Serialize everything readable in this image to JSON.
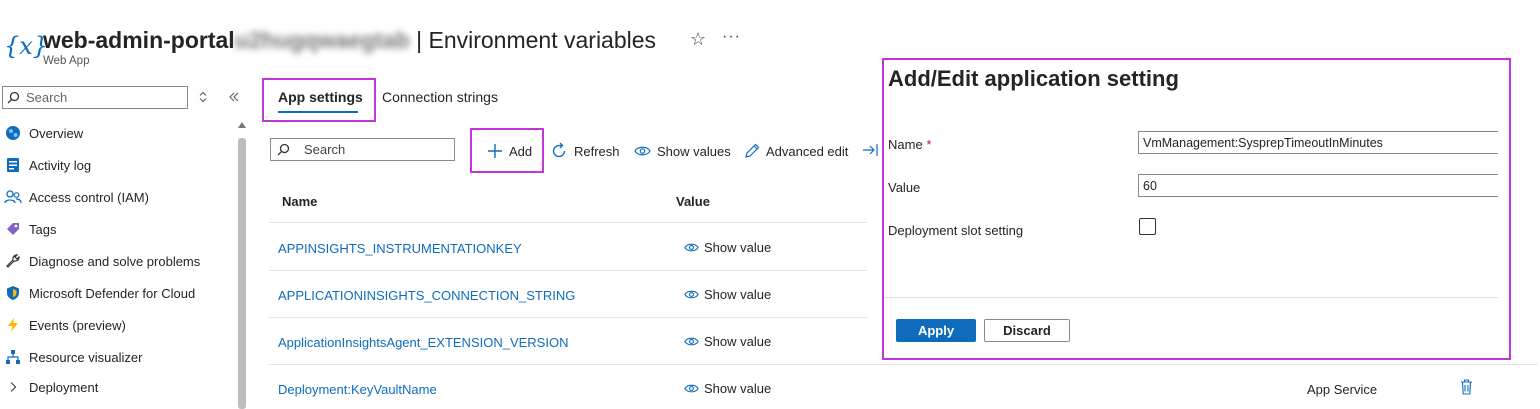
{
  "header": {
    "app_name": "web-admin-portal",
    "app_name_suffix": "u2hugqwaegtab",
    "separator_title": "| Environment variables",
    "subtitle": "Web App",
    "star_glyph": "☆",
    "more_glyph": "···"
  },
  "sidebar": {
    "search_placeholder": "Search",
    "items": [
      {
        "label": "Overview",
        "icon": "globe-icon"
      },
      {
        "label": "Activity log",
        "icon": "log-icon"
      },
      {
        "label": "Access control (IAM)",
        "icon": "people-icon"
      },
      {
        "label": "Tags",
        "icon": "tag-icon"
      },
      {
        "label": "Diagnose and solve problems",
        "icon": "wrench-icon"
      },
      {
        "label": "Microsoft Defender for Cloud",
        "icon": "shield-icon"
      },
      {
        "label": "Events (preview)",
        "icon": "lightning-icon"
      },
      {
        "label": "Resource visualizer",
        "icon": "diagram-icon"
      },
      {
        "label": "Deployment",
        "icon": "chevron-right-icon"
      }
    ]
  },
  "tabs": [
    {
      "label": "App settings",
      "active": true
    },
    {
      "label": "Connection strings",
      "active": false
    }
  ],
  "toolbar": {
    "search_placeholder": "Search",
    "add_label": "Add",
    "refresh_label": "Refresh",
    "show_values_label": "Show values",
    "advanced_edit_label": "Advanced edit"
  },
  "table": {
    "columns": [
      "Name",
      "Value"
    ],
    "rows": [
      {
        "name": "APPINSIGHTS_INSTRUMENTATIONKEY",
        "value": "Show value"
      },
      {
        "name": "APPLICATIONINSIGHTS_CONNECTION_STRING",
        "value": "Show value"
      },
      {
        "name": "ApplicationInsightsAgent_EXTENSION_VERSION",
        "value": "Show value"
      },
      {
        "name": "Deployment:KeyVaultName",
        "value": "Show value",
        "source": "App Service"
      }
    ]
  },
  "panel": {
    "title": "Add/Edit application setting",
    "name_label": "Name",
    "required_mark": "*",
    "name_value": "VmManagement:SysprepTimeoutInMinutes",
    "value_label": "Value",
    "value_value": "60",
    "slot_label": "Deployment slot setting",
    "slot_checked": false,
    "apply_label": "Apply",
    "discard_label": "Discard"
  },
  "colors": {
    "accent": "#0f6cbd",
    "highlight": "#c036d8"
  }
}
